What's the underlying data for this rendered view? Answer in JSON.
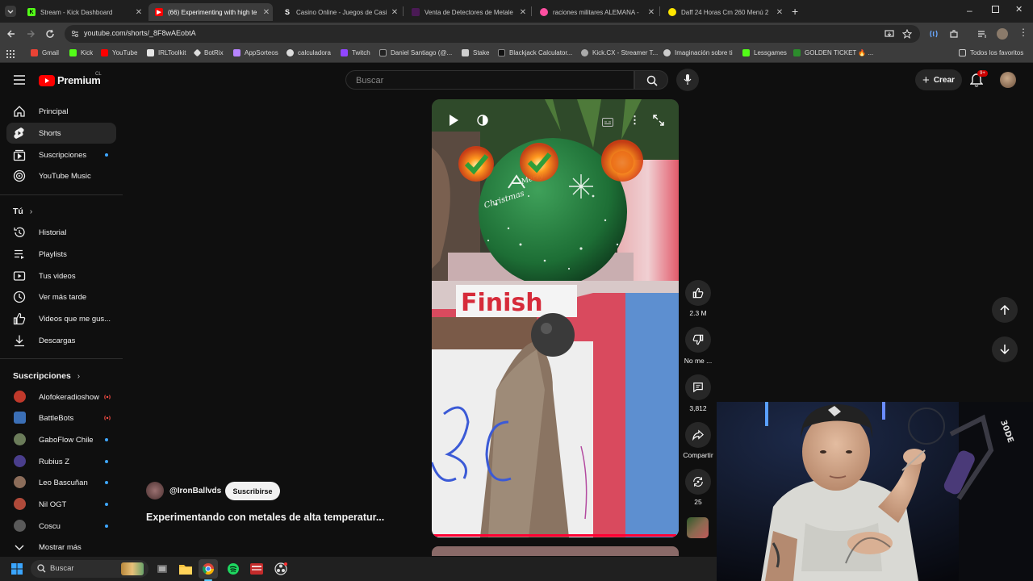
{
  "browser": {
    "tabs": [
      {
        "title": "Stream - Kick Dashboard",
        "favicon": "kick-icon",
        "color": "#53fc18"
      },
      {
        "title": "(66) Experimenting with high te",
        "favicon": "youtube-icon",
        "color": "#ff0000"
      },
      {
        "title": "Casino Online - Juegos de Casi",
        "favicon": "stake-icon",
        "color": "#ffffff"
      },
      {
        "title": "Venta de Detectores de Metale",
        "favicon": "shop-icon",
        "color": "#7a2d8a"
      },
      {
        "title": "raciones militares ALEMANA -",
        "favicon": "store-icon",
        "color": "#ff4fa1"
      },
      {
        "title": "Daff 24 Horas Cm 260 Menú 2",
        "favicon": "ml-icon",
        "color": "#ffe600"
      }
    ],
    "url": "youtube.com/shorts/_8F8wAEobtA",
    "bookmarks": [
      "Gmail",
      "Kick",
      "YouTube",
      "IRLToolkit",
      "BotRix",
      "AppSorteos",
      "calculadora",
      "Twitch",
      "Daniel Santiago (@...",
      "Stake",
      "Blackjack Calculator...",
      "Kick.CX - Streamer T...",
      "Imaginación sobre ti",
      "Lessgames",
      "GOLDEN TICKET 🔥 ..."
    ],
    "all_bookmarks": "Todos los favoritos"
  },
  "youtube": {
    "logo_text": "Premium",
    "region": "CL",
    "search_placeholder": "Buscar",
    "create_label": "Crear",
    "notifications": "9+",
    "nav_main": [
      {
        "label": "Principal",
        "icon": "home-icon"
      },
      {
        "label": "Shorts",
        "icon": "shorts-icon",
        "active": true
      },
      {
        "label": "Suscripciones",
        "icon": "subscriptions-icon",
        "dot": true
      },
      {
        "label": "YouTube Music",
        "icon": "music-icon"
      }
    ],
    "you_header": "Tú",
    "nav_you": [
      {
        "label": "Historial",
        "icon": "history-icon"
      },
      {
        "label": "Playlists",
        "icon": "playlist-icon"
      },
      {
        "label": "Tus videos",
        "icon": "video-icon"
      },
      {
        "label": "Ver más tarde",
        "icon": "clock-icon"
      },
      {
        "label": "Videos que me gus...",
        "icon": "like-icon"
      },
      {
        "label": "Descargas",
        "icon": "download-icon"
      }
    ],
    "subs_header": "Suscripciones",
    "subscriptions": [
      {
        "label": "Alofokeradioshow",
        "status": "live",
        "color": "#c0392b"
      },
      {
        "label": "BattleBots",
        "status": "live",
        "color": "#3b6fb6"
      },
      {
        "label": "GaboFlow Chile",
        "status": "dot",
        "color": "#6b7c5a"
      },
      {
        "label": "Rubius Z",
        "status": "dot",
        "color": "#4a3e8c"
      },
      {
        "label": "Leo Bascuñan",
        "status": "dot",
        "color": "#8c6d5a"
      },
      {
        "label": "Nil OGT",
        "status": "dot",
        "color": "#b04a3a"
      },
      {
        "label": "Coscu",
        "status": "dot",
        "color": "#5a5a5a"
      }
    ],
    "show_more": "Mostrar más",
    "short": {
      "channel": "@IronBallvds",
      "subscribe": "Suscribirse",
      "title": "Experimentando con metales de alta temperatur...",
      "likes": "2.3 M",
      "dislike_label": "No me ...",
      "comments": "3,812",
      "share": "Compartir",
      "remix": "25",
      "progress": 0.99
    }
  },
  "taskbar": {
    "search_placeholder": "Buscar"
  }
}
